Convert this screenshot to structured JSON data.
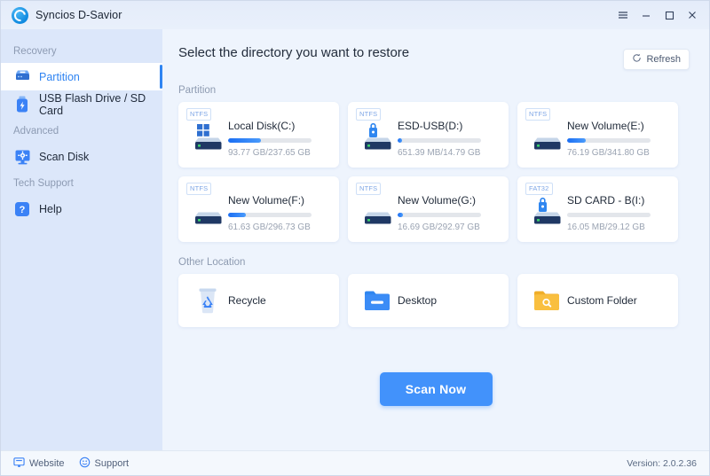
{
  "window": {
    "app_title": "Syncios D-Savior",
    "logo_icon": "syncios-logo-icon",
    "controls": [
      {
        "name": "menu-button",
        "icon": "hamburger-menu-icon"
      },
      {
        "name": "minimize-button",
        "icon": "minimize-icon"
      },
      {
        "name": "maximize-button",
        "icon": "maximize-icon"
      },
      {
        "name": "close-button",
        "icon": "close-icon"
      }
    ]
  },
  "sidebar": {
    "groups": [
      {
        "label": "Recovery",
        "items": [
          {
            "label": "Partition",
            "icon": "partition-drive-icon",
            "active": true
          },
          {
            "label": "USB Flash Drive / SD Card",
            "icon": "usb-flash-drive-icon",
            "active": false
          }
        ]
      },
      {
        "label": "Advanced",
        "items": [
          {
            "label": "Scan Disk",
            "icon": "scan-disk-monitor-icon",
            "active": false
          }
        ]
      },
      {
        "label": "Tech Support",
        "items": [
          {
            "label": "Help",
            "icon": "help-question-icon",
            "active": false
          }
        ]
      }
    ]
  },
  "main": {
    "page_title": "Select the directory you want to restore",
    "refresh_label": "Refresh",
    "refresh_icon": "refresh-circular-arrow-icon",
    "partition_section_label": "Partition",
    "other_location_section_label": "Other Location",
    "scan_button_label": "Scan Now",
    "partitions": [
      {
        "fs": "NTFS",
        "name": "Local Disk(C:)",
        "usage": "93.77 GB/237.65 GB",
        "percent": 39,
        "icon": "windows-drive-icon"
      },
      {
        "fs": "NTFS",
        "name": "ESD-USB(D:)",
        "usage": "651.39 MB/14.79 GB",
        "percent": 5,
        "icon": "locked-drive-icon"
      },
      {
        "fs": "NTFS",
        "name": "New Volume(E:)",
        "usage": "76.19 GB/341.80 GB",
        "percent": 22,
        "icon": "drive-icon"
      },
      {
        "fs": "NTFS",
        "name": "New Volume(F:)",
        "usage": "61.63 GB/296.73 GB",
        "percent": 21,
        "icon": "drive-icon"
      },
      {
        "fs": "NTFS",
        "name": "New Volume(G:)",
        "usage": "16.69 GB/292.97 GB",
        "percent": 6,
        "icon": "drive-icon"
      },
      {
        "fs": "FAT32",
        "name": "SD CARD - B(I:)",
        "usage": "16.05 MB/29.12 GB",
        "percent": 0,
        "icon": "locked-drive-icon"
      }
    ],
    "other_locations": [
      {
        "name": "Recycle",
        "icon": "recycle-bin-icon"
      },
      {
        "name": "Desktop",
        "icon": "desktop-folder-icon"
      },
      {
        "name": "Custom Folder",
        "icon": "custom-folder-search-icon"
      }
    ]
  },
  "statusbar": {
    "website_label": "Website",
    "website_icon": "monitor-icon",
    "support_label": "Support",
    "support_icon": "support-smiley-icon",
    "version_label": "Version: 2.0.2.36"
  },
  "colors": {
    "accent": "#4292fb",
    "sidebar_bg": "#dce7fa",
    "main_bg": "#eef4fd",
    "progress_fill": "#1b6ef3",
    "folder_blue": "#3b82f6",
    "folder_orange": "#f5b73c"
  }
}
